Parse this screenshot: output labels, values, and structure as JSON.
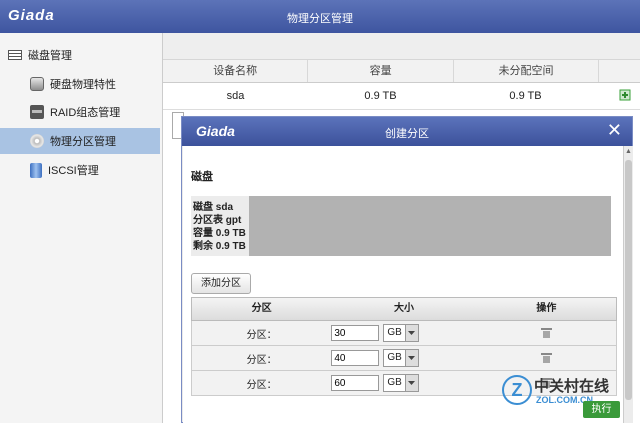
{
  "header": {
    "logo": "Giada",
    "title": "物理分区管理"
  },
  "sidebar": {
    "root_label": "磁盘管理",
    "items": [
      {
        "label": "硬盘物理特性",
        "icon": "disk-icon"
      },
      {
        "label": "RAID组态管理",
        "icon": "raid-icon"
      },
      {
        "label": "物理分区管理",
        "icon": "cd-icon",
        "active": true
      },
      {
        "label": "ISCSI管理",
        "icon": "iscsi-icon"
      }
    ]
  },
  "grid": {
    "columns": [
      "设备名称",
      "容量",
      "未分配空间"
    ],
    "rows": [
      {
        "device": "sda",
        "capacity": "0.9 TB",
        "unallocated": "0.9 TB"
      }
    ]
  },
  "modal": {
    "logo": "Giada",
    "title": "创建分区",
    "close_label": "✕",
    "section_label": "磁盘",
    "disk_info": {
      "name": "磁盘 sda",
      "partition_table": "分区表 gpt",
      "capacity": "容量 0.9 TB",
      "remaining": "剩余 0.9 TB"
    },
    "add_button": "添加分区",
    "table": {
      "columns": [
        "分区",
        "大小",
        "操作"
      ],
      "rows": [
        {
          "label": "分区：",
          "size": "30",
          "unit": "GB"
        },
        {
          "label": "分区：",
          "size": "40",
          "unit": "GB"
        },
        {
          "label": "分区：",
          "size": "60",
          "unit": "GB"
        }
      ]
    },
    "execute_button": "执行"
  },
  "watermark": {
    "logo": "Z",
    "name": "中关村在线",
    "url": "ZOL.COM.CN"
  },
  "colors": {
    "header": "#4b62ac",
    "active_item": "#a9c3e3",
    "execute": "#3a9a3a",
    "add_icon": "#3aa03a"
  }
}
